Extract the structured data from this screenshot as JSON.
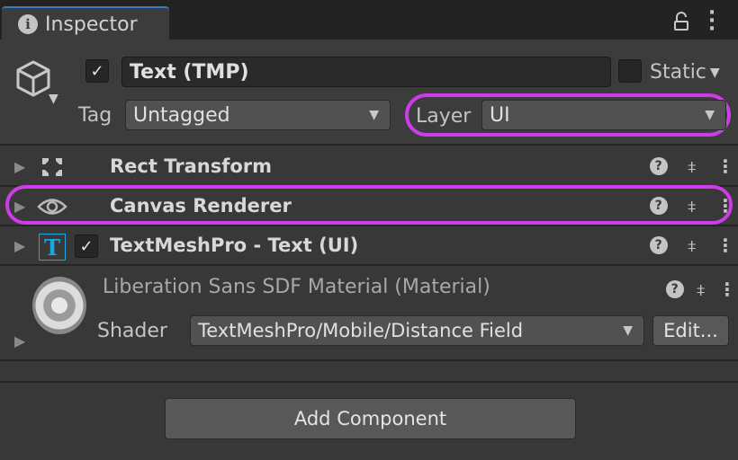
{
  "window": {
    "tab_title": "Inspector",
    "tab_icon": "info-icon",
    "lock_icon": "lock-icon",
    "menu_icon": "kebab-icon"
  },
  "gameobject": {
    "active": true,
    "name": "Text (TMP)",
    "static_checked": false,
    "static_label": "Static",
    "tag_label": "Tag",
    "tag_value": "Untagged",
    "layer_label": "Layer",
    "layer_value": "UI"
  },
  "components": [
    {
      "title": "Rect Transform",
      "icon": "rect-transform-icon",
      "has_checkbox": false
    },
    {
      "title": "Canvas Renderer",
      "icon": "eye-icon",
      "has_checkbox": false,
      "highlighted": true
    },
    {
      "title": "TextMeshPro - Text (UI)",
      "icon": "textmeshpro-icon",
      "has_checkbox": true,
      "enabled": true,
      "icon_glyph": "T"
    }
  ],
  "material": {
    "title": "Liberation Sans SDF Material (Material)",
    "shader_label": "Shader",
    "shader_value": "TextMeshPro/Mobile/Distance Field",
    "edit_label": "Edit..."
  },
  "add_component_label": "Add Component",
  "colors": {
    "highlight": "#cc3ce8",
    "tab_accent": "#3a79bb",
    "tmp_icon": "#1ca6e3"
  }
}
